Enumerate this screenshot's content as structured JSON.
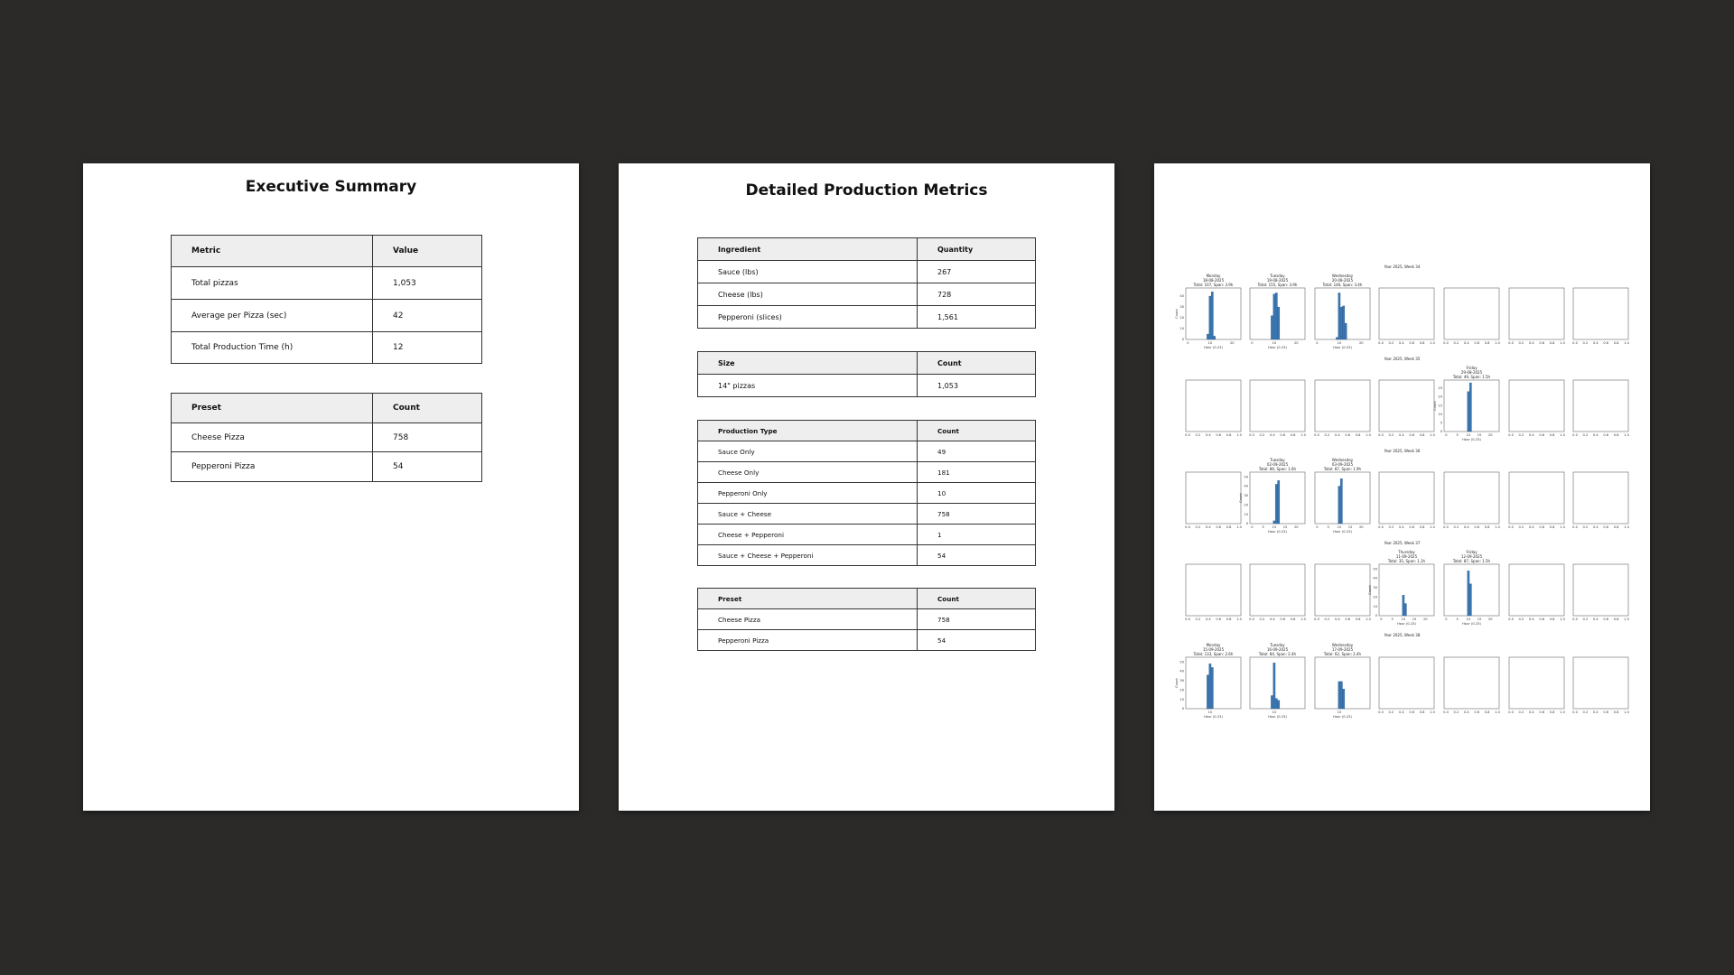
{
  "page1": {
    "title": "Executive Summary",
    "metrics_table": {
      "headers": [
        "Metric",
        "Value"
      ],
      "rows": [
        [
          "Total pizzas",
          "1,053"
        ],
        [
          "Average per Pizza (sec)",
          "42"
        ],
        [
          "Total Production Time (h)",
          "12"
        ]
      ]
    },
    "preset_table": {
      "headers": [
        "Preset",
        "Count"
      ],
      "rows": [
        [
          "Cheese Pizza",
          "758"
        ],
        [
          "Pepperoni Pizza",
          "54"
        ]
      ]
    }
  },
  "page2": {
    "title": "Detailed Production Metrics",
    "ingredient_table": {
      "headers": [
        "Ingredient",
        "Quantity"
      ],
      "rows": [
        [
          "Sauce (lbs)",
          "267"
        ],
        [
          "Cheese (lbs)",
          "728"
        ],
        [
          "Pepperoni (slices)",
          "1,561"
        ]
      ]
    },
    "size_table": {
      "headers": [
        "Size",
        "Count"
      ],
      "rows": [
        [
          "14\" pizzas",
          "1,053"
        ]
      ]
    },
    "production_type_table": {
      "headers": [
        "Production Type",
        "Count"
      ],
      "rows": [
        [
          "Sauce Only",
          "49"
        ],
        [
          "Cheese Only",
          "181"
        ],
        [
          "Pepperoni Only",
          "10"
        ],
        [
          "Sauce + Cheese",
          "758"
        ],
        [
          "Cheese + Pepperoni",
          "1"
        ],
        [
          "Sauce + Cheese + Pepperoni",
          "54"
        ]
      ]
    },
    "preset_table": {
      "headers": [
        "Preset",
        "Count"
      ],
      "rows": [
        [
          "Cheese Pizza",
          "758"
        ],
        [
          "Pepperoni Pizza",
          "54"
        ]
      ]
    }
  },
  "chart_data": {
    "type": "bar",
    "bar_color": "#3b76af",
    "ylabel": "Count",
    "xlabel": "Hour (0-23)",
    "empty_xticks": [
      "0.0",
      "0.2",
      "0.4",
      "0.6",
      "0.8",
      "1.0"
    ],
    "weeks": [
      {
        "title": "Year 2025, Week 34",
        "days": [
          {
            "day": "Monday",
            "date": "18-08-2025",
            "total": "Total: 107, Span: 3.9h",
            "xticks": [
              "0",
              "10",
              "20"
            ],
            "yticks": [
              "0",
              "10",
              "20",
              "30",
              "40"
            ],
            "ymax": 45,
            "bars": [
              {
                "x": 9,
                "y": 5
              },
              {
                "x": 10,
                "y": 40
              },
              {
                "x": 11,
                "y": 44
              },
              {
                "x": 12,
                "y": 3
              }
            ]
          },
          {
            "day": "Tuesday",
            "date": "19-08-2025",
            "total": "Total: 155, Span: 3.9h",
            "xticks": [
              "0",
              "10",
              "20"
            ],
            "yticks": [],
            "ymax": 45,
            "bars": [
              {
                "x": 9,
                "y": 22
              },
              {
                "x": 10,
                "y": 42
              },
              {
                "x": 11,
                "y": 43
              },
              {
                "x": 12,
                "y": 30
              }
            ]
          },
          {
            "day": "Wednesday",
            "date": "20-08-2025",
            "total": "Total: 146, Span: 3.4h",
            "xticks": [
              "0",
              "10",
              "20"
            ],
            "yticks": [],
            "ymax": 45,
            "bars": [
              {
                "x": 9,
                "y": 2
              },
              {
                "x": 10,
                "y": 43
              },
              {
                "x": 11,
                "y": 30
              },
              {
                "x": 12,
                "y": 31
              },
              {
                "x": 13,
                "y": 15
              }
            ]
          },
          null,
          null,
          null,
          null
        ]
      },
      {
        "title": "Year 2025, Week 35",
        "days": [
          null,
          null,
          null,
          null,
          {
            "day": "Friday",
            "date": "29-08-2025",
            "total": "Total: 49, Span: 1.5h",
            "xticks": [
              "0",
              "5",
              "10",
              "15",
              "20"
            ],
            "yticks": [
              "0",
              "5",
              "10",
              "15",
              "20",
              "25"
            ],
            "ymax": 28,
            "bars": [
              {
                "x": 10,
                "y": 23
              },
              {
                "x": 11,
                "y": 28
              }
            ]
          },
          null,
          null
        ]
      },
      {
        "title": "Year 2025, Week 36",
        "days": [
          null,
          {
            "day": "Tuesday",
            "date": "02-09-2025",
            "total": "Total: 86, Span: 1.6h",
            "xticks": [
              "0",
              "5",
              "10",
              "15",
              "20"
            ],
            "yticks": [
              "0",
              "10",
              "20",
              "30",
              "40",
              "50"
            ],
            "ymax": 52,
            "bars": [
              {
                "x": 10,
                "y": 3
              },
              {
                "x": 11,
                "y": 42
              },
              {
                "x": 12,
                "y": 46
              }
            ]
          },
          {
            "day": "Wednesday",
            "date": "03-09-2025",
            "total": "Total: 87, Span: 1.9h",
            "xticks": [
              "0",
              "5",
              "10",
              "15",
              "20"
            ],
            "yticks": [],
            "ymax": 52,
            "bars": [
              {
                "x": 10,
                "y": 40
              },
              {
                "x": 11,
                "y": 48
              }
            ]
          },
          null,
          null,
          null,
          null
        ]
      },
      {
        "title": "Year 2025, Week 37",
        "days": [
          null,
          null,
          null,
          {
            "day": "Thursday",
            "date": "11-09-2025",
            "total": "Total: 35, Span: 1.1h",
            "xticks": [
              "0",
              "5",
              "10",
              "15",
              "20"
            ],
            "yticks": [
              "0",
              "10",
              "20",
              "30",
              "40",
              "50"
            ],
            "ymax": 52,
            "bars": [
              {
                "x": 10,
                "y": 22
              },
              {
                "x": 11,
                "y": 13
              }
            ]
          },
          {
            "day": "Friday",
            "date": "12-09-2025",
            "total": "Total: 87, Span: 1.5h",
            "xticks": [
              "0",
              "5",
              "10",
              "15",
              "20"
            ],
            "yticks": [],
            "ymax": 52,
            "bars": [
              {
                "x": 10,
                "y": 48
              },
              {
                "x": 11,
                "y": 34
              }
            ]
          },
          null,
          null
        ]
      },
      {
        "title": "Year 2025, Week 38",
        "days": [
          {
            "day": "Monday",
            "date": "15-09-2025",
            "total": "Total: 133, Span: 2.6h",
            "xticks": [
              "10"
            ],
            "yticks": [
              "0",
              "10",
              "20",
              "30",
              "40",
              "50"
            ],
            "ymax": 52,
            "bars": [
              {
                "x": 9,
                "y": 36
              },
              {
                "x": 10,
                "y": 48
              },
              {
                "x": 11,
                "y": 44
              }
            ]
          },
          {
            "day": "Tuesday",
            "date": "16-09-2025",
            "total": "Total: 84, Span: 2.4h",
            "xticks": [
              "10"
            ],
            "yticks": [],
            "ymax": 52,
            "bars": [
              {
                "x": 9,
                "y": 14
              },
              {
                "x": 10,
                "y": 49
              },
              {
                "x": 11,
                "y": 11
              },
              {
                "x": 12,
                "y": 9
              }
            ]
          },
          {
            "day": "Wednesday",
            "date": "17-09-2025",
            "total": "Total: 62, Span: 2.4h",
            "xticks": [
              "10"
            ],
            "yticks": [],
            "ymax": 52,
            "bars": [
              {
                "x": 10,
                "y": 29
              },
              {
                "x": 11,
                "y": 29
              },
              {
                "x": 12,
                "y": 21
              }
            ]
          },
          null,
          null,
          null,
          null
        ]
      }
    ]
  }
}
